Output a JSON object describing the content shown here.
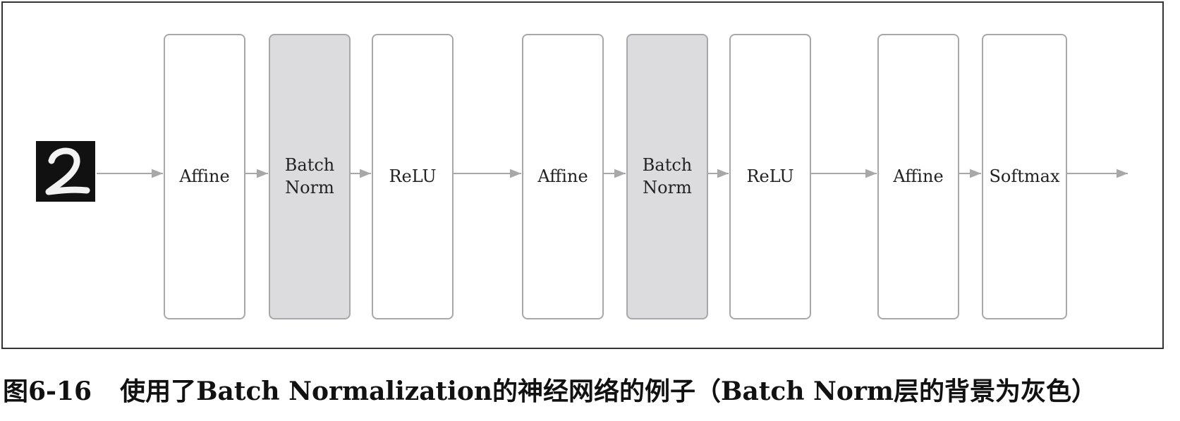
{
  "input": {
    "image": "handwritten-digit-2"
  },
  "layers": [
    {
      "label": "Affine",
      "type": "normal"
    },
    {
      "label": "Batch\nNorm",
      "type": "batchnorm"
    },
    {
      "label": "ReLU",
      "type": "normal"
    },
    {
      "label": "Affine",
      "type": "normal"
    },
    {
      "label": "Batch\nNorm",
      "type": "batchnorm"
    },
    {
      "label": "ReLU",
      "type": "normal"
    },
    {
      "label": "Affine",
      "type": "normal"
    },
    {
      "label": "Softmax",
      "type": "normal"
    }
  ],
  "caption": {
    "number": "图6-16",
    "text": "使用了Batch Normalization的神经网络的例子（Batch Norm层的背景为灰色）"
  },
  "colors": {
    "batchnorm_fill": "#dcdcdf",
    "box_border": "#a8a8a8",
    "arrow": "#a8a8a8"
  }
}
